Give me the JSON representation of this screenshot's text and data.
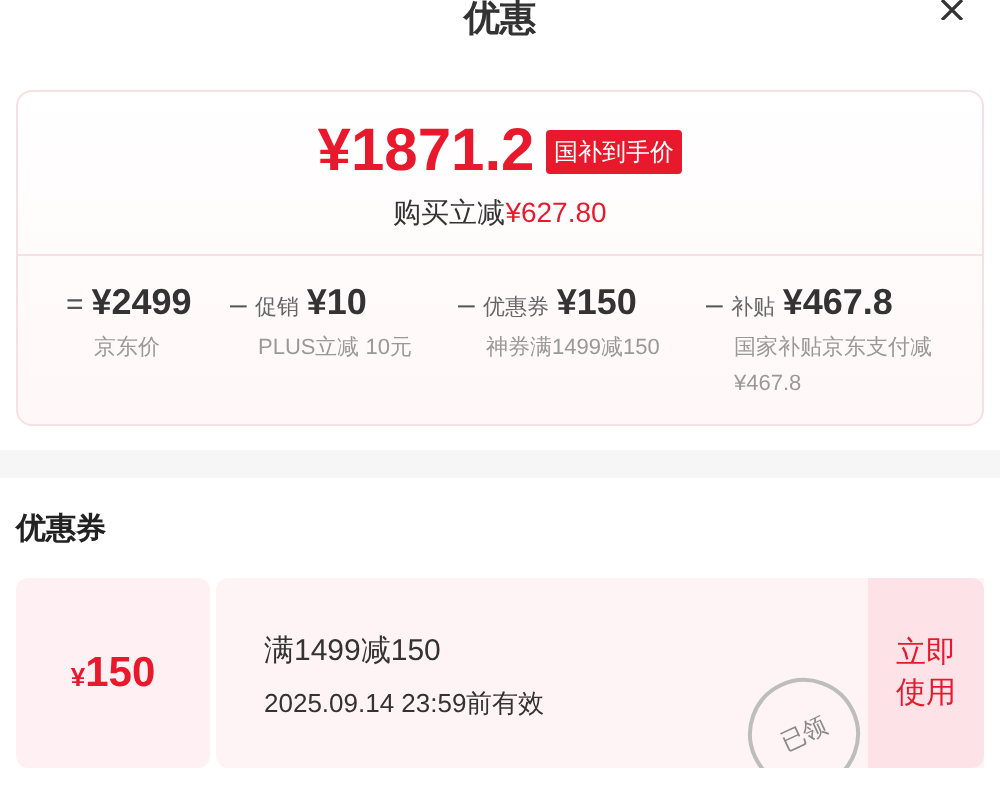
{
  "header": {
    "title": "优惠"
  },
  "summary": {
    "price": "¥1871.2",
    "price_tag": "国补到手价",
    "saving_label": "购买立减",
    "saving_amount": "¥627.80",
    "breakdown": [
      {
        "operator": "=",
        "amount": "¥2499",
        "note": "京东价"
      },
      {
        "operator": "–",
        "label": "促销",
        "amount": "¥10",
        "note": "PLUS立减 10元"
      },
      {
        "operator": "–",
        "label": "优惠券",
        "amount": "¥150",
        "note": "神券满1499减150"
      },
      {
        "operator": "–",
        "label": "补贴",
        "amount": "¥467.8",
        "note": "国家补贴京东支付减¥467.8"
      }
    ]
  },
  "coupons_section": {
    "title": "优惠券",
    "coupons": [
      {
        "currency": "¥",
        "value": "150",
        "condition": "满1499减150",
        "expiry": "2025.09.14 23:59前有效",
        "stamp": "已领",
        "action": "立即使用"
      }
    ]
  }
}
